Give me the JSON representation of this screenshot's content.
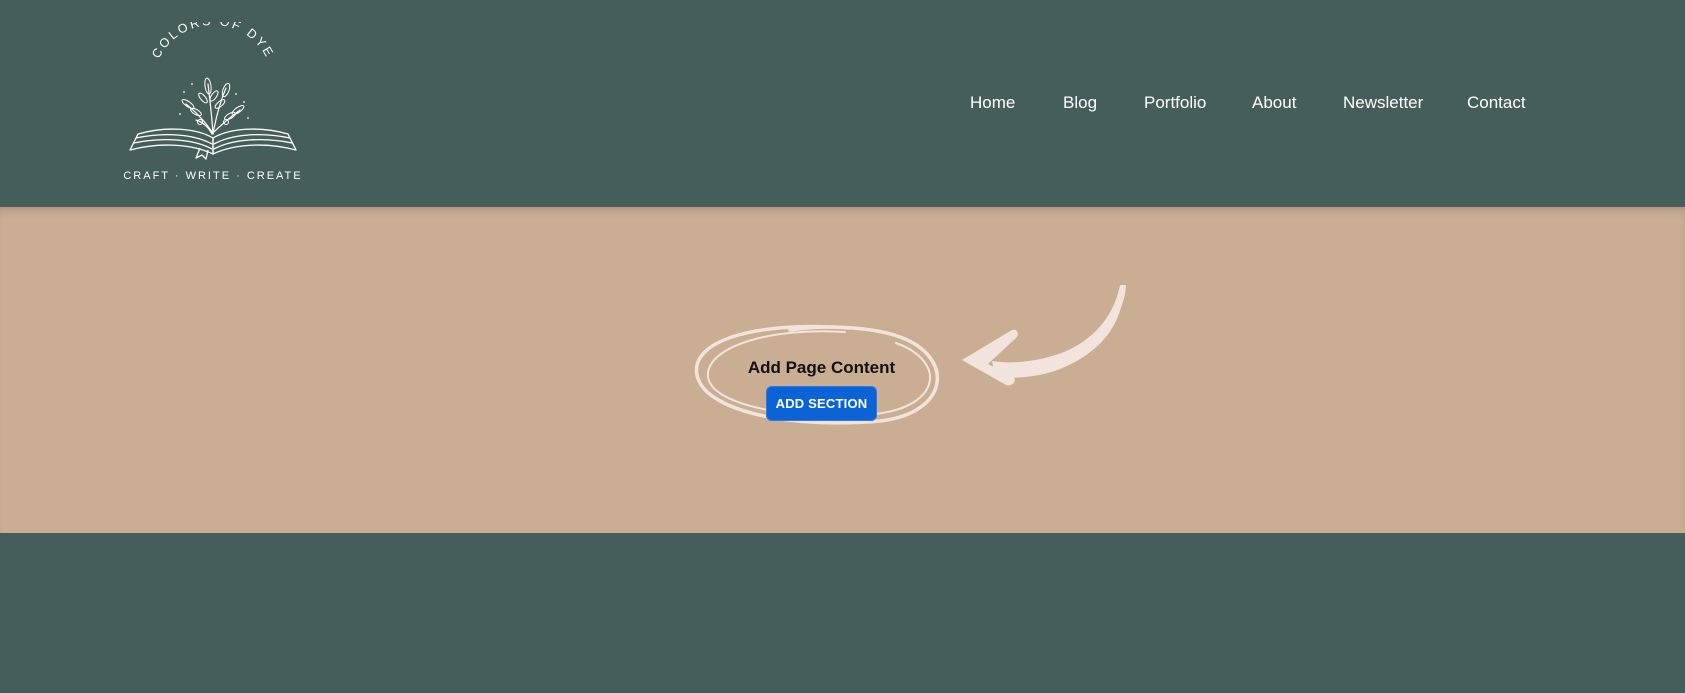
{
  "logo": {
    "arc_text": "COLORS OF DYE",
    "tagline": "CRAFT · WRITE · CREATE",
    "icon": "open-book-with-plant-icon"
  },
  "nav": {
    "items": [
      "Home",
      "Blog",
      "Portfolio",
      "About",
      "Newsletter",
      "Contact"
    ]
  },
  "main": {
    "heading": "Add Page Content",
    "button_label": "ADD SECTION"
  },
  "colors": {
    "header_bg": "#465e5b",
    "content_bg": "#c9ae93",
    "button_bg": "#0b63d6",
    "accent_stroke": "#f2e4dc"
  }
}
